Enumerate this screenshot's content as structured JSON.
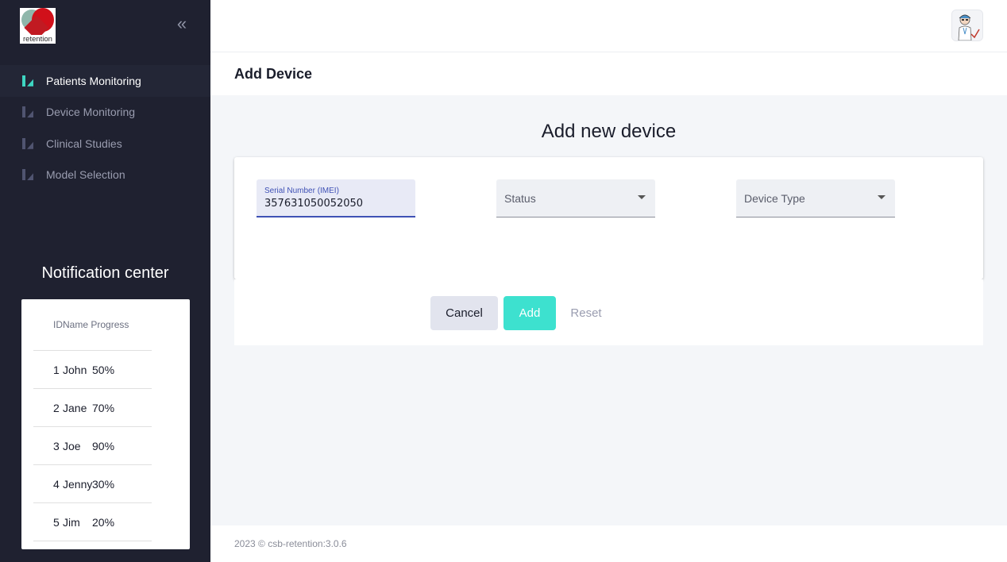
{
  "sidebar": {
    "logo_text": "retention",
    "collapse_icon": "double-chevron-left-icon",
    "items": [
      {
        "label": "Patients Monitoring",
        "active": true
      },
      {
        "label": "Device Monitoring",
        "active": false
      },
      {
        "label": "Clinical Studies",
        "active": false
      },
      {
        "label": "Model Selection",
        "active": false
      }
    ]
  },
  "notifications": {
    "title": "Notification center",
    "headers": {
      "id": "ID",
      "name": "Name",
      "progress": "Progress"
    },
    "rows": [
      {
        "id": "1",
        "name": "John",
        "progress": "50%"
      },
      {
        "id": "2",
        "name": "Jane",
        "progress": "70%"
      },
      {
        "id": "3",
        "name": "Joe",
        "progress": "90%"
      },
      {
        "id": "4",
        "name": "Jenny",
        "progress": "30%"
      },
      {
        "id": "5",
        "name": "Jim",
        "progress": "20%"
      }
    ]
  },
  "header": {
    "page_title": "Add Device",
    "avatar_icon": "doctor-avatar-icon"
  },
  "form": {
    "title": "Add new device",
    "serial": {
      "label": "Serial Number (IMEI)",
      "value": "357631050052050"
    },
    "status": {
      "label": "Status"
    },
    "device_type": {
      "label": "Device Type"
    }
  },
  "actions": {
    "cancel": "Cancel",
    "add": "Add",
    "reset": "Reset"
  },
  "footer": {
    "text": "2023 ©  csb-retention:3.0.6"
  },
  "colors": {
    "sidebar_bg": "#1f2130",
    "accent": "#3de1cf",
    "focus": "#3f51b5"
  }
}
